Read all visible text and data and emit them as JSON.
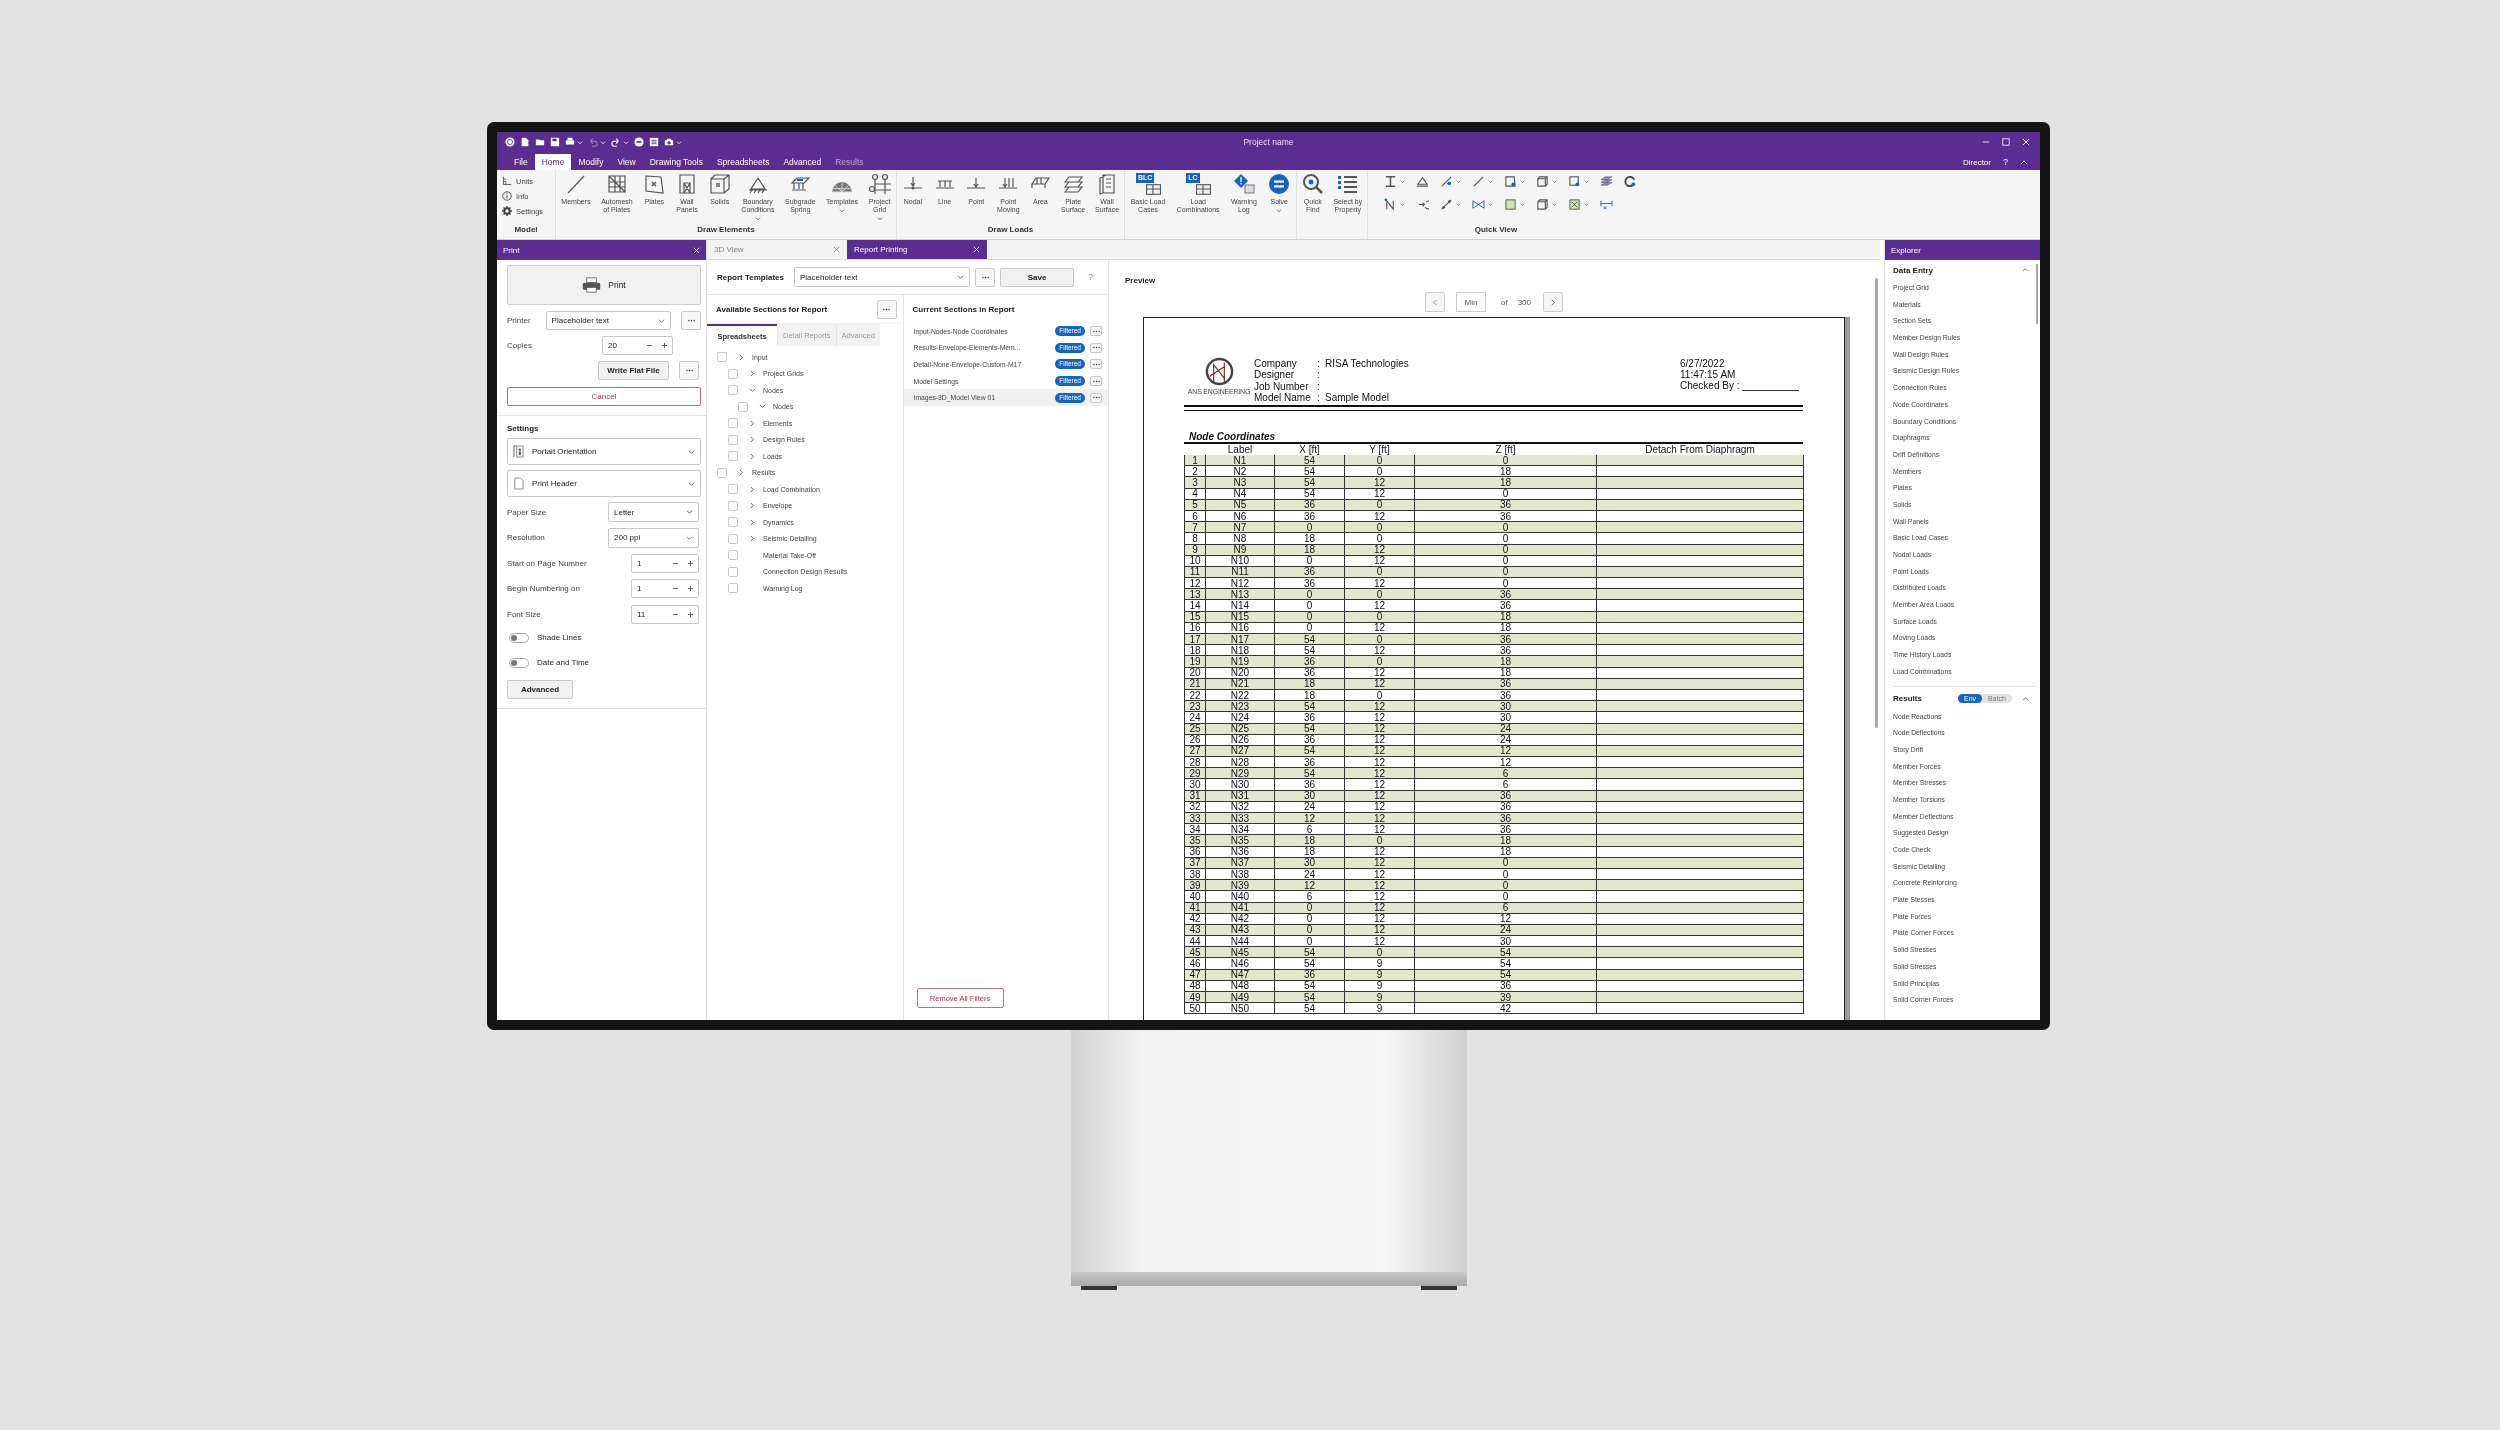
{
  "window": {
    "title": "Project name",
    "user": "Director",
    "help": "?"
  },
  "menu": [
    {
      "label": "File",
      "selected": false,
      "disabled": false
    },
    {
      "label": "Home",
      "selected": true,
      "disabled": false
    },
    {
      "label": "Modify",
      "selected": false,
      "disabled": false
    },
    {
      "label": "View",
      "selected": false,
      "disabled": false
    },
    {
      "label": "Drawing Tools",
      "selected": false,
      "disabled": false
    },
    {
      "label": "Spreadsheets",
      "selected": false,
      "disabled": false
    },
    {
      "label": "Advanced",
      "selected": false,
      "disabled": false
    },
    {
      "label": "Results",
      "selected": false,
      "disabled": true
    }
  ],
  "ribbon": {
    "groups": [
      {
        "kind": "small",
        "label": "Model",
        "items": [
          "Units",
          "Info",
          "Settings"
        ]
      },
      {
        "kind": "large",
        "label": "Draw Elements",
        "items": [
          {
            "label": "Members",
            "dropdown": false
          },
          {
            "label": "Automesh\nof Plates",
            "dropdown": false
          },
          {
            "label": "Plates",
            "dropdown": false
          },
          {
            "label": "Wall\nPanels",
            "dropdown": false
          },
          {
            "label": "Solids",
            "dropdown": false
          },
          {
            "label": "Boundary\nConditions",
            "dropdown": true
          },
          {
            "label": "Subgrade\nSpring",
            "dropdown": false
          },
          {
            "label": "Templates",
            "dropdown": true
          },
          {
            "label": "Project\nGrid",
            "dropdown": true
          }
        ]
      },
      {
        "kind": "large",
        "label": "Draw Loads",
        "items": [
          {
            "label": "Nodal",
            "dropdown": false
          },
          {
            "label": "Line",
            "dropdown": false
          },
          {
            "label": "Point",
            "dropdown": false
          },
          {
            "label": "Point\nMoving",
            "dropdown": false
          },
          {
            "label": "Area",
            "dropdown": false
          },
          {
            "label": "Plate\nSurface",
            "dropdown": false
          },
          {
            "label": "Wall\nSurface",
            "dropdown": false
          }
        ]
      },
      {
        "kind": "large",
        "items": [
          {
            "label": "Basic Load\nCases",
            "badge": "BLC",
            "dropdown": false
          },
          {
            "label": "Load\nCombinations",
            "badge": "LC",
            "dropdown": false
          },
          {
            "label": "Warning\nLog",
            "dropdown": false
          },
          {
            "label": "Solve",
            "dropdown": true
          }
        ]
      },
      {
        "kind": "large",
        "items": [
          {
            "label": "Quick\nFind",
            "dropdown": false
          },
          {
            "label": "Select by\nProperty",
            "dropdown": false
          }
        ]
      },
      {
        "kind": "grid",
        "label": "Quick View"
      }
    ]
  },
  "print_panel": {
    "title": "Print",
    "print_button": "Print",
    "printer": {
      "label": "Printer",
      "value": "Placeholder text"
    },
    "copies": {
      "label": "Copies",
      "value": "20"
    },
    "write_flat_file": "Write Flat File",
    "cancel": "Cancel",
    "settings_title": "Settings",
    "orientation": "Portait Orientation",
    "header": "Print Header",
    "fields": [
      {
        "label": "Paper Size",
        "kind": "select",
        "value": "Letter"
      },
      {
        "label": "Resolution",
        "kind": "select",
        "value": "200 ppi"
      },
      {
        "label": "Start on Page Number",
        "kind": "spinner",
        "value": "1"
      },
      {
        "label": "Begin Numbering on",
        "kind": "spinner",
        "value": "1"
      },
      {
        "label": "Font Size",
        "kind": "spinner",
        "value": "11"
      }
    ],
    "toggles": [
      {
        "label": "Shade Lines",
        "on": false
      },
      {
        "label": "Date and Time",
        "on": false
      }
    ],
    "advanced": "Advanced"
  },
  "doc_tabs": [
    {
      "label": "3D View",
      "selected": false
    },
    {
      "label": "Report Printing",
      "selected": true
    }
  ],
  "report": {
    "templates_label": "Report Templates",
    "template": "Placeholder text",
    "save": "Save",
    "help": "?",
    "available_title": "Available Sections for Report",
    "section_tabs": [
      {
        "label": "Spreadsheets",
        "selected": true
      },
      {
        "label": "Detail Reports",
        "selected": false
      },
      {
        "label": "Advanced",
        "selected": false
      }
    ],
    "tree": [
      {
        "label": "Input",
        "kind": "group",
        "expanded": false,
        "checked": false,
        "children": [
          {
            "label": "Project Grids",
            "kind": "group",
            "expanded": false,
            "checked": false
          },
          {
            "label": "Nodes",
            "kind": "group",
            "expanded": true,
            "checked": false,
            "children": [
              {
                "label": "Nodes",
                "kind": "group",
                "expanded": true,
                "checked": false
              }
            ]
          },
          {
            "label": "Elements",
            "kind": "group",
            "expanded": false,
            "checked": false
          },
          {
            "label": "Design Rules",
            "kind": "group",
            "expanded": false,
            "checked": false
          },
          {
            "label": "Loads",
            "kind": "group",
            "expanded": false,
            "checked": false
          }
        ]
      },
      {
        "label": "Results",
        "kind": "group",
        "expanded": false,
        "checked": false,
        "children": [
          {
            "label": "Load Combination",
            "kind": "group",
            "expanded": false,
            "checked": false
          },
          {
            "label": "Envelope",
            "kind": "group",
            "expanded": false,
            "checked": false
          },
          {
            "label": "Dynamics",
            "kind": "group",
            "expanded": false,
            "checked": false
          },
          {
            "label": "Seismic Detailing",
            "kind": "group",
            "expanded": false,
            "checked": false
          },
          {
            "label": "Material Take-Off",
            "kind": "leaf",
            "checked": false
          },
          {
            "label": "Connection Design Results",
            "kind": "leaf",
            "checked": false
          },
          {
            "label": "Warning Log",
            "kind": "leaf",
            "checked": false
          }
        ]
      }
    ],
    "current_title": "Current Sections in Report",
    "current": [
      {
        "label": "Input-Nodes-Node Coordinates",
        "badge": "Filtered",
        "selected": false
      },
      {
        "label": "Results-Envelope-Elements-Mem...",
        "badge": "Filtered",
        "selected": false
      },
      {
        "label": "Detail-None-Envelope-Custom-M17",
        "badge": "Filtered",
        "selected": false
      },
      {
        "label": "Model Settings",
        "badge": "Filtered",
        "selected": false
      },
      {
        "label": "Images-3D_Model View 01",
        "badge": "Filtered",
        "selected": true
      }
    ],
    "remove_filters": "Remove All Filters"
  },
  "preview": {
    "title": "Preview",
    "page_field": "Min",
    "of": "of",
    "total": "300",
    "page": {
      "logo_text": "ANS ENGINEERING",
      "info": [
        {
          "label": "Company",
          "sep": ":",
          "value": "RISA Technologies"
        },
        {
          "label": "Designer",
          "sep": ":"
        },
        {
          "label": "Job Number",
          "sep": ":"
        },
        {
          "label": "Model Name",
          "sep": ":",
          "value": "Sample Model"
        }
      ],
      "date": "6/27/2022",
      "time": "11:47:15 AM",
      "checked_by": "Checked By :",
      "section_title": "Node Coordinates",
      "table": {
        "columns": [
          "",
          "Label",
          "X [ft]",
          "Y [ft]",
          "Z [ft]",
          "Detach From Diaphragm"
        ],
        "rows": [
          [
            "1",
            "N1",
            "54",
            "0",
            "0"
          ],
          [
            "2",
            "N2",
            "54",
            "0",
            "18"
          ],
          [
            "3",
            "N3",
            "54",
            "12",
            "18"
          ],
          [
            "4",
            "N4",
            "54",
            "12",
            "0"
          ],
          [
            "5",
            "N5",
            "36",
            "0",
            "36"
          ],
          [
            "6",
            "N6",
            "36",
            "12",
            "36"
          ],
          [
            "7",
            "N7",
            "0",
            "0",
            "0"
          ],
          [
            "8",
            "N8",
            "18",
            "0",
            "0"
          ],
          [
            "9",
            "N9",
            "18",
            "12",
            "0"
          ],
          [
            "10",
            "N10",
            "0",
            "12",
            "0"
          ],
          [
            "11",
            "N11",
            "36",
            "0",
            "0"
          ],
          [
            "12",
            "N12",
            "36",
            "12",
            "0"
          ],
          [
            "13",
            "N13",
            "0",
            "0",
            "36"
          ],
          [
            "14",
            "N14",
            "0",
            "12",
            "36"
          ],
          [
            "15",
            "N15",
            "0",
            "0",
            "18"
          ],
          [
            "16",
            "N16",
            "0",
            "12",
            "18"
          ],
          [
            "17",
            "N17",
            "54",
            "0",
            "36"
          ],
          [
            "18",
            "N18",
            "54",
            "12",
            "36"
          ],
          [
            "19",
            "N19",
            "36",
            "0",
            "18"
          ],
          [
            "20",
            "N20",
            "36",
            "12",
            "18"
          ],
          [
            "21",
            "N21",
            "18",
            "12",
            "36"
          ],
          [
            "22",
            "N22",
            "18",
            "0",
            "36"
          ],
          [
            "23",
            "N23",
            "54",
            "12",
            "30"
          ],
          [
            "24",
            "N24",
            "36",
            "12",
            "30"
          ],
          [
            "25",
            "N25",
            "54",
            "12",
            "24"
          ],
          [
            "26",
            "N26",
            "36",
            "12",
            "24"
          ],
          [
            "27",
            "N27",
            "54",
            "12",
            "12"
          ],
          [
            "28",
            "N28",
            "36",
            "12",
            "12"
          ],
          [
            "29",
            "N29",
            "54",
            "12",
            "6"
          ],
          [
            "30",
            "N30",
            "36",
            "12",
            "6"
          ],
          [
            "31",
            "N31",
            "30",
            "12",
            "36"
          ],
          [
            "32",
            "N32",
            "24",
            "12",
            "36"
          ],
          [
            "33",
            "N33",
            "12",
            "12",
            "36"
          ],
          [
            "34",
            "N34",
            "6",
            "12",
            "36"
          ],
          [
            "35",
            "N35",
            "18",
            "0",
            "18"
          ],
          [
            "36",
            "N36",
            "18",
            "12",
            "18"
          ],
          [
            "37",
            "N37",
            "30",
            "12",
            "0"
          ],
          [
            "38",
            "N38",
            "24",
            "12",
            "0"
          ],
          [
            "39",
            "N39",
            "12",
            "12",
            "0"
          ],
          [
            "40",
            "N40",
            "6",
            "12",
            "0"
          ],
          [
            "41",
            "N41",
            "0",
            "12",
            "6"
          ],
          [
            "42",
            "N42",
            "0",
            "12",
            "12"
          ],
          [
            "43",
            "N43",
            "0",
            "12",
            "24"
          ],
          [
            "44",
            "N44",
            "0",
            "12",
            "30"
          ],
          [
            "45",
            "N45",
            "54",
            "0",
            "54"
          ],
          [
            "46",
            "N46",
            "54",
            "9",
            "54"
          ],
          [
            "47",
            "N47",
            "36",
            "9",
            "54"
          ],
          [
            "48",
            "N48",
            "54",
            "9",
            "36"
          ],
          [
            "49",
            "N49",
            "54",
            "9",
            "39"
          ],
          [
            "50",
            "N50",
            "54",
            "9",
            "42"
          ]
        ]
      }
    }
  },
  "explorer": {
    "title": "Explorer",
    "sections": [
      {
        "title": "Data Entry",
        "expanded": true,
        "items": [
          "Project Grid",
          "Materials",
          "Section Sets",
          "Member Design Rules",
          "Wall Design Rules",
          "Seismic Design Rules",
          "Connection Rules",
          "Node Coordinates",
          "Boundary Conditions",
          "Diaphragms",
          "Drift Definitions",
          "Members",
          "Plates",
          "Solids",
          "Wall Panels",
          "Basic Load Cases",
          "Nodal Loads",
          "Point Loads",
          "Distributed Loads",
          "Member Area Loads",
          "Surface Loads",
          "Moving Loads",
          "Time History Loads",
          "Load Combinations"
        ]
      },
      {
        "title": "Results",
        "expanded": true,
        "switch": [
          {
            "label": "Env",
            "selected": true
          },
          {
            "label": "Batch",
            "selected": false
          }
        ],
        "items": [
          "Node Reactions",
          "Node Deflections",
          "Story Drift",
          "Member Forces",
          "Member Stresses",
          "Member Torsions",
          "Member Deflections",
          "Suggested Design",
          "Code Check",
          "Seismic Detailing",
          "Concrete Reinforcing",
          "Plate Stesses",
          "Plate Forces",
          "Plate Corner Forces",
          "Solid Stresses",
          "Solid Stresses",
          "Solid Principlas",
          "Solid Corner Forces"
        ]
      }
    ]
  }
}
